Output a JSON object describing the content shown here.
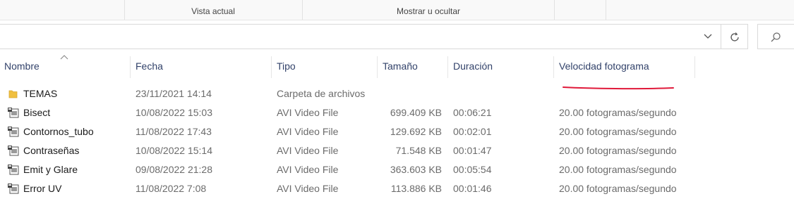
{
  "ribbon": {
    "groups": [
      "Vista actual",
      "Mostrar u ocultar"
    ]
  },
  "columns": {
    "name": "Nombre",
    "date": "Fecha",
    "type": "Tipo",
    "size": "Tamaño",
    "duration": "Duración",
    "framerate": "Velocidad fotograma"
  },
  "colors": {
    "header_text": "#32426a",
    "annotation_underline": "#e0193a",
    "folder_icon": "#f0c040"
  },
  "files": [
    {
      "icon": "folder-icon",
      "name": "TEMAS",
      "date": "23/11/2021 14:14",
      "type": "Carpeta de archivos",
      "size": "",
      "duration": "",
      "framerate": ""
    },
    {
      "icon": "video-file-icon",
      "name": "Bisect",
      "date": "10/08/2022 15:03",
      "type": "AVI Video File",
      "size": "699.409 KB",
      "duration": "00:06:21",
      "framerate": "20.00 fotogramas/segundo"
    },
    {
      "icon": "video-file-icon",
      "name": "Contornos_tubo",
      "date": "11/08/2022 17:43",
      "type": "AVI Video File",
      "size": "129.692 KB",
      "duration": "00:02:01",
      "framerate": "20.00 fotogramas/segundo"
    },
    {
      "icon": "video-file-icon",
      "name": "Contraseñas",
      "date": "10/08/2022 15:14",
      "type": "AVI Video File",
      "size": "71.548 KB",
      "duration": "00:01:47",
      "framerate": "20.00 fotogramas/segundo"
    },
    {
      "icon": "video-file-icon",
      "name": "Emit y Glare",
      "date": "09/08/2022 21:28",
      "type": "AVI Video File",
      "size": "363.603 KB",
      "duration": "00:05:54",
      "framerate": "20.00 fotogramas/segundo"
    },
    {
      "icon": "video-file-icon",
      "name": "Error UV",
      "date": "11/08/2022 7:08",
      "type": "AVI Video File",
      "size": "113.886 KB",
      "duration": "00:01:46",
      "framerate": "20.00 fotogramas/segundo"
    }
  ]
}
